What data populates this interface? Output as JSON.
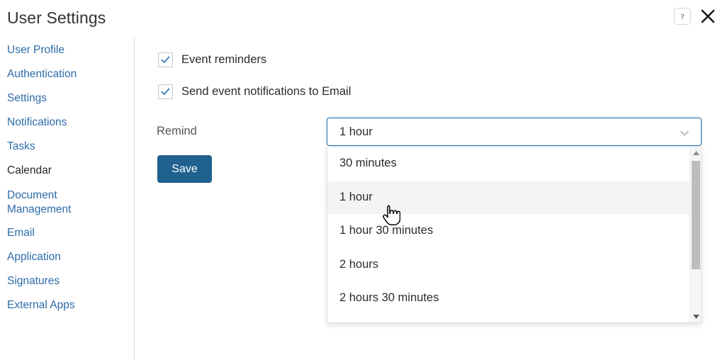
{
  "header": {
    "title": "User Settings",
    "help_icon": "question-mark-icon",
    "close_icon": "close-x-icon"
  },
  "sidebar": {
    "items": [
      {
        "label": "User Profile",
        "active": false
      },
      {
        "label": "Authentication",
        "active": false
      },
      {
        "label": "Settings",
        "active": false
      },
      {
        "label": "Notifications",
        "active": false
      },
      {
        "label": "Tasks",
        "active": false
      },
      {
        "label": "Calendar",
        "active": true
      },
      {
        "label": "Document Management",
        "active": false
      },
      {
        "label": "Email",
        "active": false
      },
      {
        "label": "Application",
        "active": false
      },
      {
        "label": "Signatures",
        "active": false
      },
      {
        "label": "External Apps",
        "active": false
      }
    ]
  },
  "main": {
    "checkboxes": [
      {
        "label": "Event reminders",
        "checked": true
      },
      {
        "label": "Send event notifications to Email",
        "checked": true
      }
    ],
    "remind_label": "Remind",
    "save_label": "Save",
    "select": {
      "value": "1 hour",
      "caret_icon": "chevron-down-icon",
      "expanded": true,
      "options": [
        {
          "label": "30 minutes",
          "hovered": false
        },
        {
          "label": "1 hour",
          "hovered": true
        },
        {
          "label": "1 hour 30 minutes",
          "hovered": false
        },
        {
          "label": "2 hours",
          "hovered": false
        },
        {
          "label": "2 hours 30 minutes",
          "hovered": false
        }
      ],
      "scrollbar": {
        "up_icon": "scroll-up-arrow-icon",
        "down_icon": "scroll-down-arrow-icon"
      }
    }
  },
  "cursor": {
    "icon": "pointing-hand-cursor"
  },
  "colors": {
    "link": "#2d6ca8",
    "active_text": "#2a2a2a",
    "primary_button": "#20618f",
    "focus_border": "#2d73ad",
    "checkmark": "#2d73ad",
    "hover_row": "#f4f4f4"
  }
}
